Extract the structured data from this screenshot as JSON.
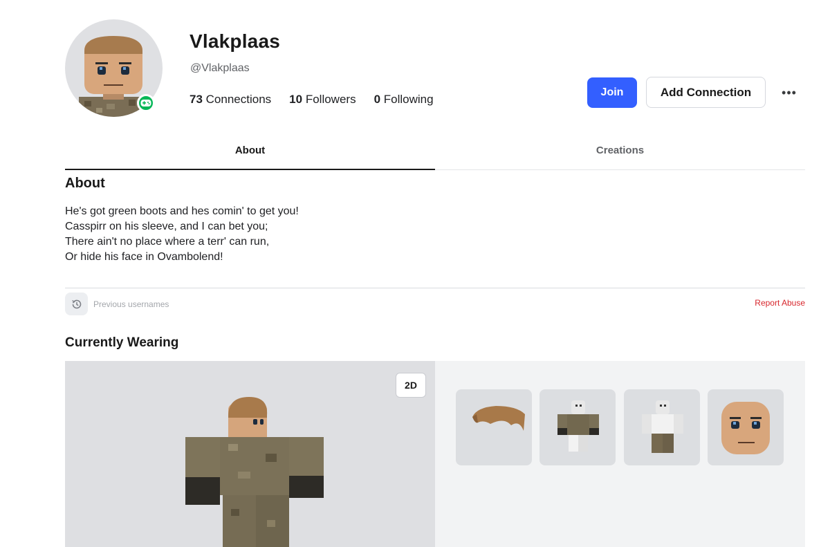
{
  "profile": {
    "display_name": "Vlakplaas",
    "username": "@Vlakplaas",
    "presence": "in-game",
    "presence_color": "#02b757"
  },
  "stats": [
    {
      "count": "73",
      "label": "Connections"
    },
    {
      "count": "10",
      "label": "Followers"
    },
    {
      "count": "0",
      "label": "Following"
    }
  ],
  "actions": {
    "join_label": "Join",
    "add_connection_label": "Add Connection",
    "more_label": "•••"
  },
  "tabs": [
    {
      "label": "About",
      "active": true
    },
    {
      "label": "Creations",
      "active": false
    }
  ],
  "about": {
    "heading": "About",
    "lines": [
      "He's got green boots and hes comin' to get you!",
      "Casspirr on his sleeve, and I can bet you;",
      "There ain't no place where a terr' can run,",
      "Or hide his face in Ovambolend!"
    ]
  },
  "footer": {
    "previous_usernames_label": "Previous usernames",
    "report_abuse_label": "Report Abuse"
  },
  "wearing": {
    "heading": "Currently Wearing",
    "toggle_label": "2D",
    "items": [
      {
        "name": "hair-item",
        "icon": "brown-hair"
      },
      {
        "name": "shirt-item",
        "icon": "camo-shirt"
      },
      {
        "name": "pants-item",
        "icon": "camo-pants"
      },
      {
        "name": "face-item",
        "icon": "face"
      }
    ]
  },
  "colors": {
    "accent": "#335fff",
    "report": "#d7262c"
  }
}
